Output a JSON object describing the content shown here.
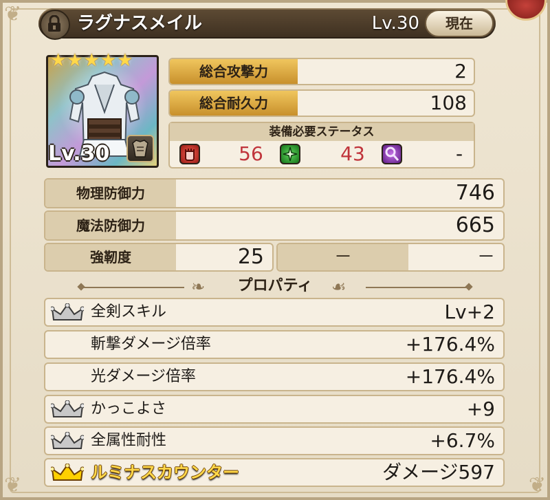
{
  "header": {
    "item_name": "ラグナスメイル",
    "level_label": "Lv.30",
    "current_button": "現在"
  },
  "portrait": {
    "stars": "★★★★★",
    "level_label": "Lv.30",
    "star_count": 5
  },
  "stats": {
    "attack_label": "総合攻撃力",
    "attack_value": "2",
    "durability_label": "総合耐久力",
    "durability_value": "108"
  },
  "requirements": {
    "title": "装備必要ステータス",
    "str_value": "56",
    "dex_value": "43",
    "mag_value": "-"
  },
  "defense": {
    "phys_label": "物理防御力",
    "phys_value": "746",
    "mag_label": "魔法防御力",
    "mag_value": "665",
    "tough_label": "強靭度",
    "tough_value": "25",
    "extra_label": "－",
    "extra_value": "－"
  },
  "properties": {
    "title": "プロパティ",
    "rows": [
      {
        "name": "全剣スキル",
        "value": "Lv+2"
      },
      {
        "name": "斬撃ダメージ倍率",
        "value": "+176.4%"
      },
      {
        "name": "光ダメージ倍率",
        "value": "+176.4%"
      },
      {
        "name": "かっこよさ",
        "value": "+9"
      },
      {
        "name": "全属性耐性",
        "value": "+6.7%"
      },
      {
        "name": "ルミナスカウンター",
        "value": "ダメージ597"
      }
    ]
  },
  "colors": {
    "accent_gold": "#f0c65e",
    "requirement_red": "#c0343b",
    "crown_silver": "#b9b9b9",
    "crown_gold": "#ffd000"
  }
}
